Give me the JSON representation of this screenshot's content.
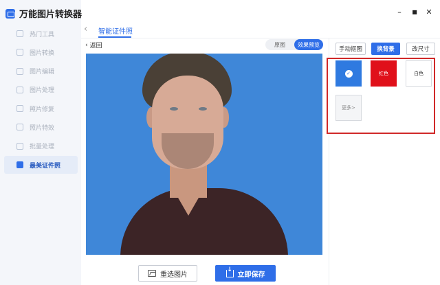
{
  "app": {
    "name": "万能图片转换器"
  },
  "sidebar": {
    "items": [
      {
        "label": "热门工具"
      },
      {
        "label": "图片转换"
      },
      {
        "label": "图片编辑"
      },
      {
        "label": "图片处理"
      },
      {
        "label": "照片修复"
      },
      {
        "label": "照片特效"
      },
      {
        "label": "批量处理"
      },
      {
        "label": "最美证件照",
        "active": true
      }
    ]
  },
  "window": {
    "minimize": "–",
    "maximize": "■",
    "close": "✕"
  },
  "header": {
    "title": "智能证件照",
    "back_icon": "chevron-left-icon"
  },
  "toolbar": {
    "return_label": "返回",
    "view_toggle": [
      {
        "label": "原图"
      },
      {
        "label": "效果预览",
        "selected": true
      }
    ]
  },
  "tools": [
    {
      "label": "手动抠图"
    },
    {
      "label": "换背景",
      "selected": true
    },
    {
      "label": "改尺寸"
    }
  ],
  "backgrounds": {
    "blue": {
      "color": "#2f7ae0",
      "selected": true
    },
    "red": {
      "label": "红色",
      "color": "#e0101a"
    },
    "white": {
      "label": "白色",
      "color": "#ffffff"
    },
    "more_label": "更多>"
  },
  "photo": {
    "background_color": "#3f87d8"
  },
  "actions": {
    "reselect_label": "重选图片",
    "save_label": "立即保存"
  }
}
